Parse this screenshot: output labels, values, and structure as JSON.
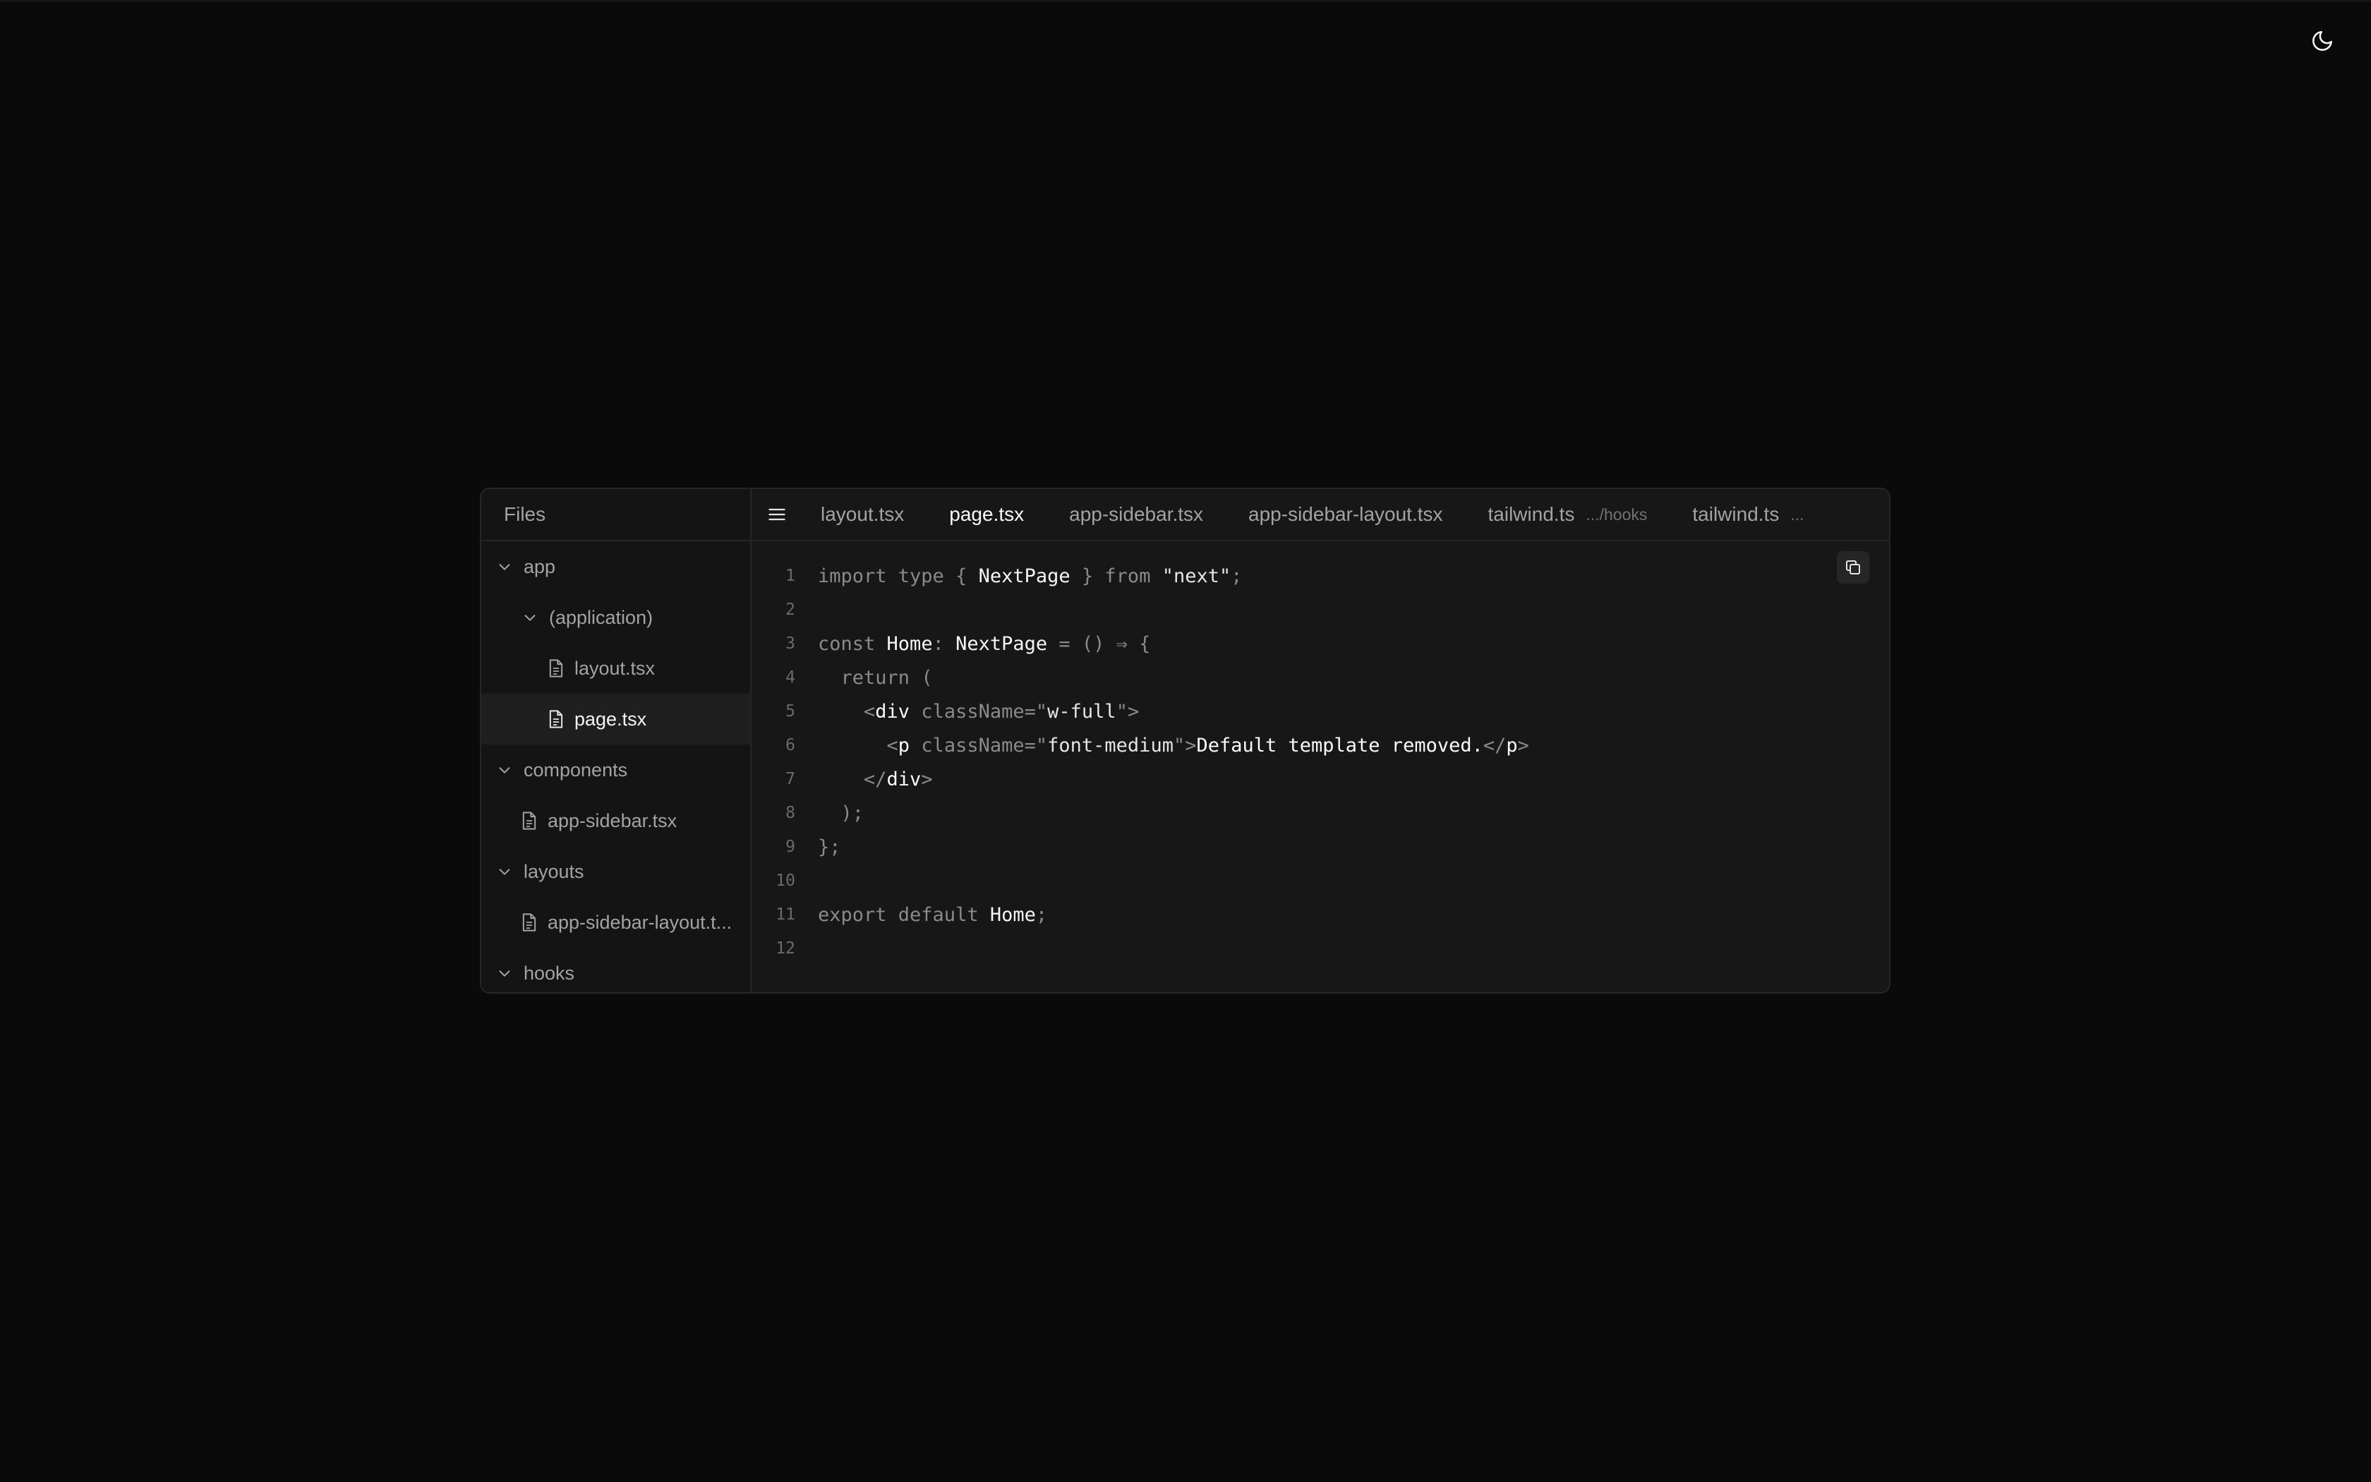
{
  "sidebar": {
    "title": "Files",
    "tree": [
      {
        "name": "app",
        "type": "folder",
        "level": 0
      },
      {
        "name": "(application)",
        "type": "folder",
        "level": 1
      },
      {
        "name": "layout.tsx",
        "type": "file",
        "level": 2
      },
      {
        "name": "page.tsx",
        "type": "file",
        "level": 2,
        "active": true
      },
      {
        "name": "components",
        "type": "folder",
        "level": 0
      },
      {
        "name": "app-sidebar.tsx",
        "type": "file",
        "level": 1
      },
      {
        "name": "layouts",
        "type": "folder",
        "level": 0
      },
      {
        "name": "app-sidebar-layout.t...",
        "type": "file",
        "level": 1
      },
      {
        "name": "hooks",
        "type": "folder",
        "level": 0
      }
    ]
  },
  "tabs": [
    {
      "label": "layout.tsx",
      "active": false,
      "hint": ""
    },
    {
      "label": "page.tsx",
      "active": true,
      "hint": ""
    },
    {
      "label": "app-sidebar.tsx",
      "active": false,
      "hint": ""
    },
    {
      "label": "app-sidebar-layout.tsx",
      "active": false,
      "hint": ""
    },
    {
      "label": "tailwind.ts",
      "active": false,
      "hint": ".../hooks"
    },
    {
      "label": "tailwind.ts",
      "active": false,
      "hint": "..."
    }
  ],
  "code": {
    "line_numbers": [
      "1",
      "2",
      "3",
      "4",
      "5",
      "6",
      "7",
      "8",
      "9",
      "10",
      "11",
      "12"
    ],
    "lines": [
      [
        {
          "t": "kw",
          "v": "import type "
        },
        {
          "t": "p",
          "v": "{ "
        },
        {
          "t": "id",
          "v": "NextPage"
        },
        {
          "t": "p",
          "v": " } "
        },
        {
          "t": "kw",
          "v": "from "
        },
        {
          "t": "str",
          "v": "\"next\""
        },
        {
          "t": "p",
          "v": ";"
        }
      ],
      [],
      [
        {
          "t": "kw",
          "v": "const "
        },
        {
          "t": "id",
          "v": "Home"
        },
        {
          "t": "p",
          "v": ": "
        },
        {
          "t": "id",
          "v": "NextPage"
        },
        {
          "t": "p",
          "v": " = () ⇒ {"
        }
      ],
      [
        {
          "t": "kw",
          "v": "  return "
        },
        {
          "t": "p",
          "v": "("
        }
      ],
      [
        {
          "t": "p",
          "v": "    <"
        },
        {
          "t": "tag",
          "v": "div"
        },
        {
          "t": "attr",
          "v": " className="
        },
        {
          "t": "p",
          "v": "\""
        },
        {
          "t": "str",
          "v": "w-full"
        },
        {
          "t": "p",
          "v": "\">"
        }
      ],
      [
        {
          "t": "p",
          "v": "      <"
        },
        {
          "t": "tag",
          "v": "p"
        },
        {
          "t": "attr",
          "v": " className="
        },
        {
          "t": "p",
          "v": "\""
        },
        {
          "t": "str",
          "v": "font-medium"
        },
        {
          "t": "p",
          "v": "\">"
        },
        {
          "t": "text",
          "v": "Default template removed."
        },
        {
          "t": "p",
          "v": "</"
        },
        {
          "t": "tag",
          "v": "p"
        },
        {
          "t": "p",
          "v": ">"
        }
      ],
      [
        {
          "t": "p",
          "v": "    </"
        },
        {
          "t": "tag",
          "v": "div"
        },
        {
          "t": "p",
          "v": ">"
        }
      ],
      [
        {
          "t": "p",
          "v": "  );"
        }
      ],
      [
        {
          "t": "p",
          "v": "};"
        }
      ],
      [],
      [
        {
          "t": "kw",
          "v": "export default "
        },
        {
          "t": "id",
          "v": "Home"
        },
        {
          "t": "p",
          "v": ";"
        }
      ],
      []
    ]
  },
  "icons": {
    "theme_toggle": "moon-icon",
    "menu": "menu-icon",
    "copy": "copy-icon",
    "folder_chevron": "chevron-down-icon",
    "file": "file-icon"
  },
  "colors": {
    "background": "#0a0a0a",
    "panel": "#171717",
    "border": "#262626",
    "active_text": "#fafafa",
    "muted_text": "#a3a3a3"
  }
}
